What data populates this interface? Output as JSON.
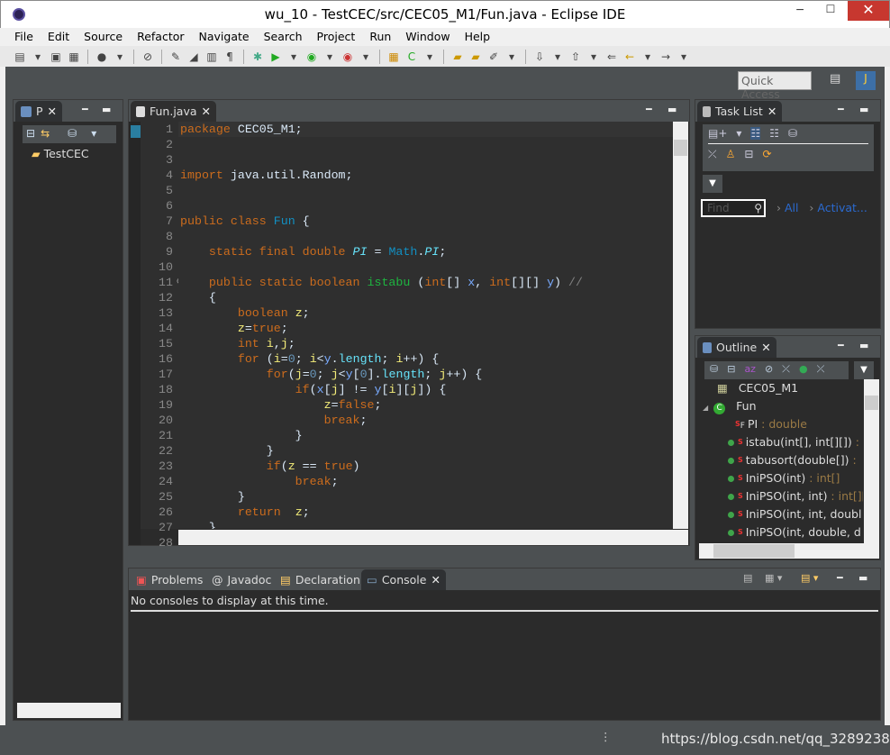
{
  "window": {
    "title": "wu_10 - TestCEC/src/CEC05_M1/Fun.java - Eclipse IDE",
    "minimize": "─",
    "maximize": "☐",
    "close": "✕"
  },
  "menu": [
    "File",
    "Edit",
    "Source",
    "Refactor",
    "Navigate",
    "Search",
    "Project",
    "Run",
    "Window",
    "Help"
  ],
  "quick_access": "Quick Access",
  "package_explorer": {
    "tab": "P",
    "tree": [
      {
        "label": "TestCEC",
        "icon": "project-icon"
      }
    ]
  },
  "editor": {
    "tab": "Fun.java",
    "lines": [
      [
        [
          "k",
          "package"
        ],
        [
          "t",
          " CEC05_M1;"
        ]
      ],
      [],
      [],
      [
        [
          "k",
          "import"
        ],
        [
          "t",
          " java.util.Random;"
        ]
      ],
      [],
      [],
      [
        [
          "k",
          "public class "
        ],
        [
          "c",
          "Fun"
        ],
        [
          "t",
          " {"
        ]
      ],
      [],
      [
        [
          "t",
          "    "
        ],
        [
          "k",
          "static final double "
        ],
        [
          "f",
          "PI"
        ],
        [
          "t",
          " = "
        ],
        [
          "c",
          "Math"
        ],
        [
          "t",
          "."
        ],
        [
          "f",
          "PI"
        ],
        [
          "t",
          ";"
        ]
      ],
      [],
      [
        [
          "t",
          "    "
        ],
        [
          "k",
          "public static boolean "
        ],
        [
          "m",
          "istabu"
        ],
        [
          "t",
          " ("
        ],
        [
          "k",
          "int"
        ],
        [
          "t",
          "[] "
        ],
        [
          "p",
          "x"
        ],
        [
          "t",
          ", "
        ],
        [
          "k",
          "int"
        ],
        [
          "t",
          "[][] "
        ],
        [
          "p",
          "y"
        ],
        [
          "t",
          ") "
        ],
        [
          "cm",
          "//"
        ]
      ],
      [
        [
          "t",
          "    {"
        ]
      ],
      [
        [
          "t",
          "        "
        ],
        [
          "k",
          "boolean "
        ],
        [
          "v",
          "z"
        ],
        [
          "t",
          ";"
        ]
      ],
      [
        [
          "t",
          "        "
        ],
        [
          "v",
          "z"
        ],
        [
          "t",
          "="
        ],
        [
          "k",
          "true"
        ],
        [
          "t",
          ";"
        ]
      ],
      [
        [
          "t",
          "        "
        ],
        [
          "k",
          "int "
        ],
        [
          "v",
          "i"
        ],
        [
          "t",
          ","
        ],
        [
          "v",
          "j"
        ],
        [
          "t",
          ";"
        ]
      ],
      [
        [
          "t",
          "        "
        ],
        [
          "k",
          "for"
        ],
        [
          "t",
          " ("
        ],
        [
          "v",
          "i"
        ],
        [
          "t",
          "="
        ],
        [
          "n",
          "0"
        ],
        [
          "t",
          "; "
        ],
        [
          "v",
          "i"
        ],
        [
          "t",
          "<"
        ],
        [
          "p",
          "y"
        ],
        [
          "t",
          "."
        ],
        [
          "fd",
          "length"
        ],
        [
          "t",
          "; "
        ],
        [
          "v",
          "i"
        ],
        [
          "t",
          "++) {"
        ]
      ],
      [
        [
          "t",
          "            "
        ],
        [
          "k",
          "for"
        ],
        [
          "t",
          "("
        ],
        [
          "v",
          "j"
        ],
        [
          "t",
          "="
        ],
        [
          "n",
          "0"
        ],
        [
          "t",
          "; "
        ],
        [
          "v",
          "j"
        ],
        [
          "t",
          "<"
        ],
        [
          "p",
          "y"
        ],
        [
          "t",
          "["
        ],
        [
          "n",
          "0"
        ],
        [
          "t",
          "]."
        ],
        [
          "fd",
          "length"
        ],
        [
          "t",
          "; "
        ],
        [
          "v",
          "j"
        ],
        [
          "t",
          "++) {"
        ]
      ],
      [
        [
          "t",
          "                "
        ],
        [
          "k",
          "if"
        ],
        [
          "t",
          "("
        ],
        [
          "p",
          "x"
        ],
        [
          "t",
          "["
        ],
        [
          "v",
          "j"
        ],
        [
          "t",
          "] != "
        ],
        [
          "p",
          "y"
        ],
        [
          "t",
          "["
        ],
        [
          "v",
          "i"
        ],
        [
          "t",
          "]["
        ],
        [
          "v",
          "j"
        ],
        [
          "t",
          "]) {"
        ]
      ],
      [
        [
          "t",
          "                    "
        ],
        [
          "v",
          "z"
        ],
        [
          "t",
          "="
        ],
        [
          "k",
          "false"
        ],
        [
          "t",
          ";"
        ]
      ],
      [
        [
          "t",
          "                    "
        ],
        [
          "k",
          "break"
        ],
        [
          "t",
          ";"
        ]
      ],
      [
        [
          "t",
          "                }"
        ]
      ],
      [
        [
          "t",
          "            }"
        ]
      ],
      [
        [
          "t",
          "            "
        ],
        [
          "k",
          "if"
        ],
        [
          "t",
          "("
        ],
        [
          "v",
          "z"
        ],
        [
          "t",
          " == "
        ],
        [
          "k",
          "true"
        ],
        [
          "t",
          ")"
        ]
      ],
      [
        [
          "t",
          "                "
        ],
        [
          "k",
          "break"
        ],
        [
          "t",
          ";"
        ]
      ],
      [
        [
          "t",
          "        }"
        ]
      ],
      [
        [
          "t",
          "        "
        ],
        [
          "k",
          "return"
        ],
        [
          "t",
          "  "
        ],
        [
          "v",
          "z"
        ],
        [
          "t",
          ";"
        ]
      ],
      [
        [
          "t",
          "    }"
        ]
      ],
      []
    ]
  },
  "task_list": {
    "tab": "Task List",
    "find_placeholder": "Find",
    "all": "All",
    "activate": "Activat..."
  },
  "outline": {
    "tab": "Outline",
    "items": [
      {
        "name": "CEC05_M1",
        "type": "",
        "kind": "package"
      },
      {
        "name": "Fun",
        "type": "",
        "kind": "class"
      },
      {
        "name": "PI",
        "type": " : double",
        "kind": "field"
      },
      {
        "name": "istabu(int[], int[][])",
        "type": " : b",
        "kind": "method"
      },
      {
        "name": "tabusort(double[])",
        "type": " :",
        "kind": "method"
      },
      {
        "name": "IniPSO(int)",
        "type": " : int[]",
        "kind": "method"
      },
      {
        "name": "IniPSO(int, int)",
        "type": " : int[][]",
        "kind": "method"
      },
      {
        "name": "IniPSO(int, int, doubl",
        "type": "",
        "kind": "method"
      },
      {
        "name": "IniPSO(int, double, d",
        "type": "",
        "kind": "method"
      }
    ]
  },
  "bottom": {
    "tabs": [
      "Problems",
      "Javadoc",
      "Declaration",
      "Console"
    ],
    "active": "Console",
    "message": "No consoles to display at this time."
  },
  "status": {
    "watermark": "https://blog.csdn.net/qq_32892383"
  }
}
